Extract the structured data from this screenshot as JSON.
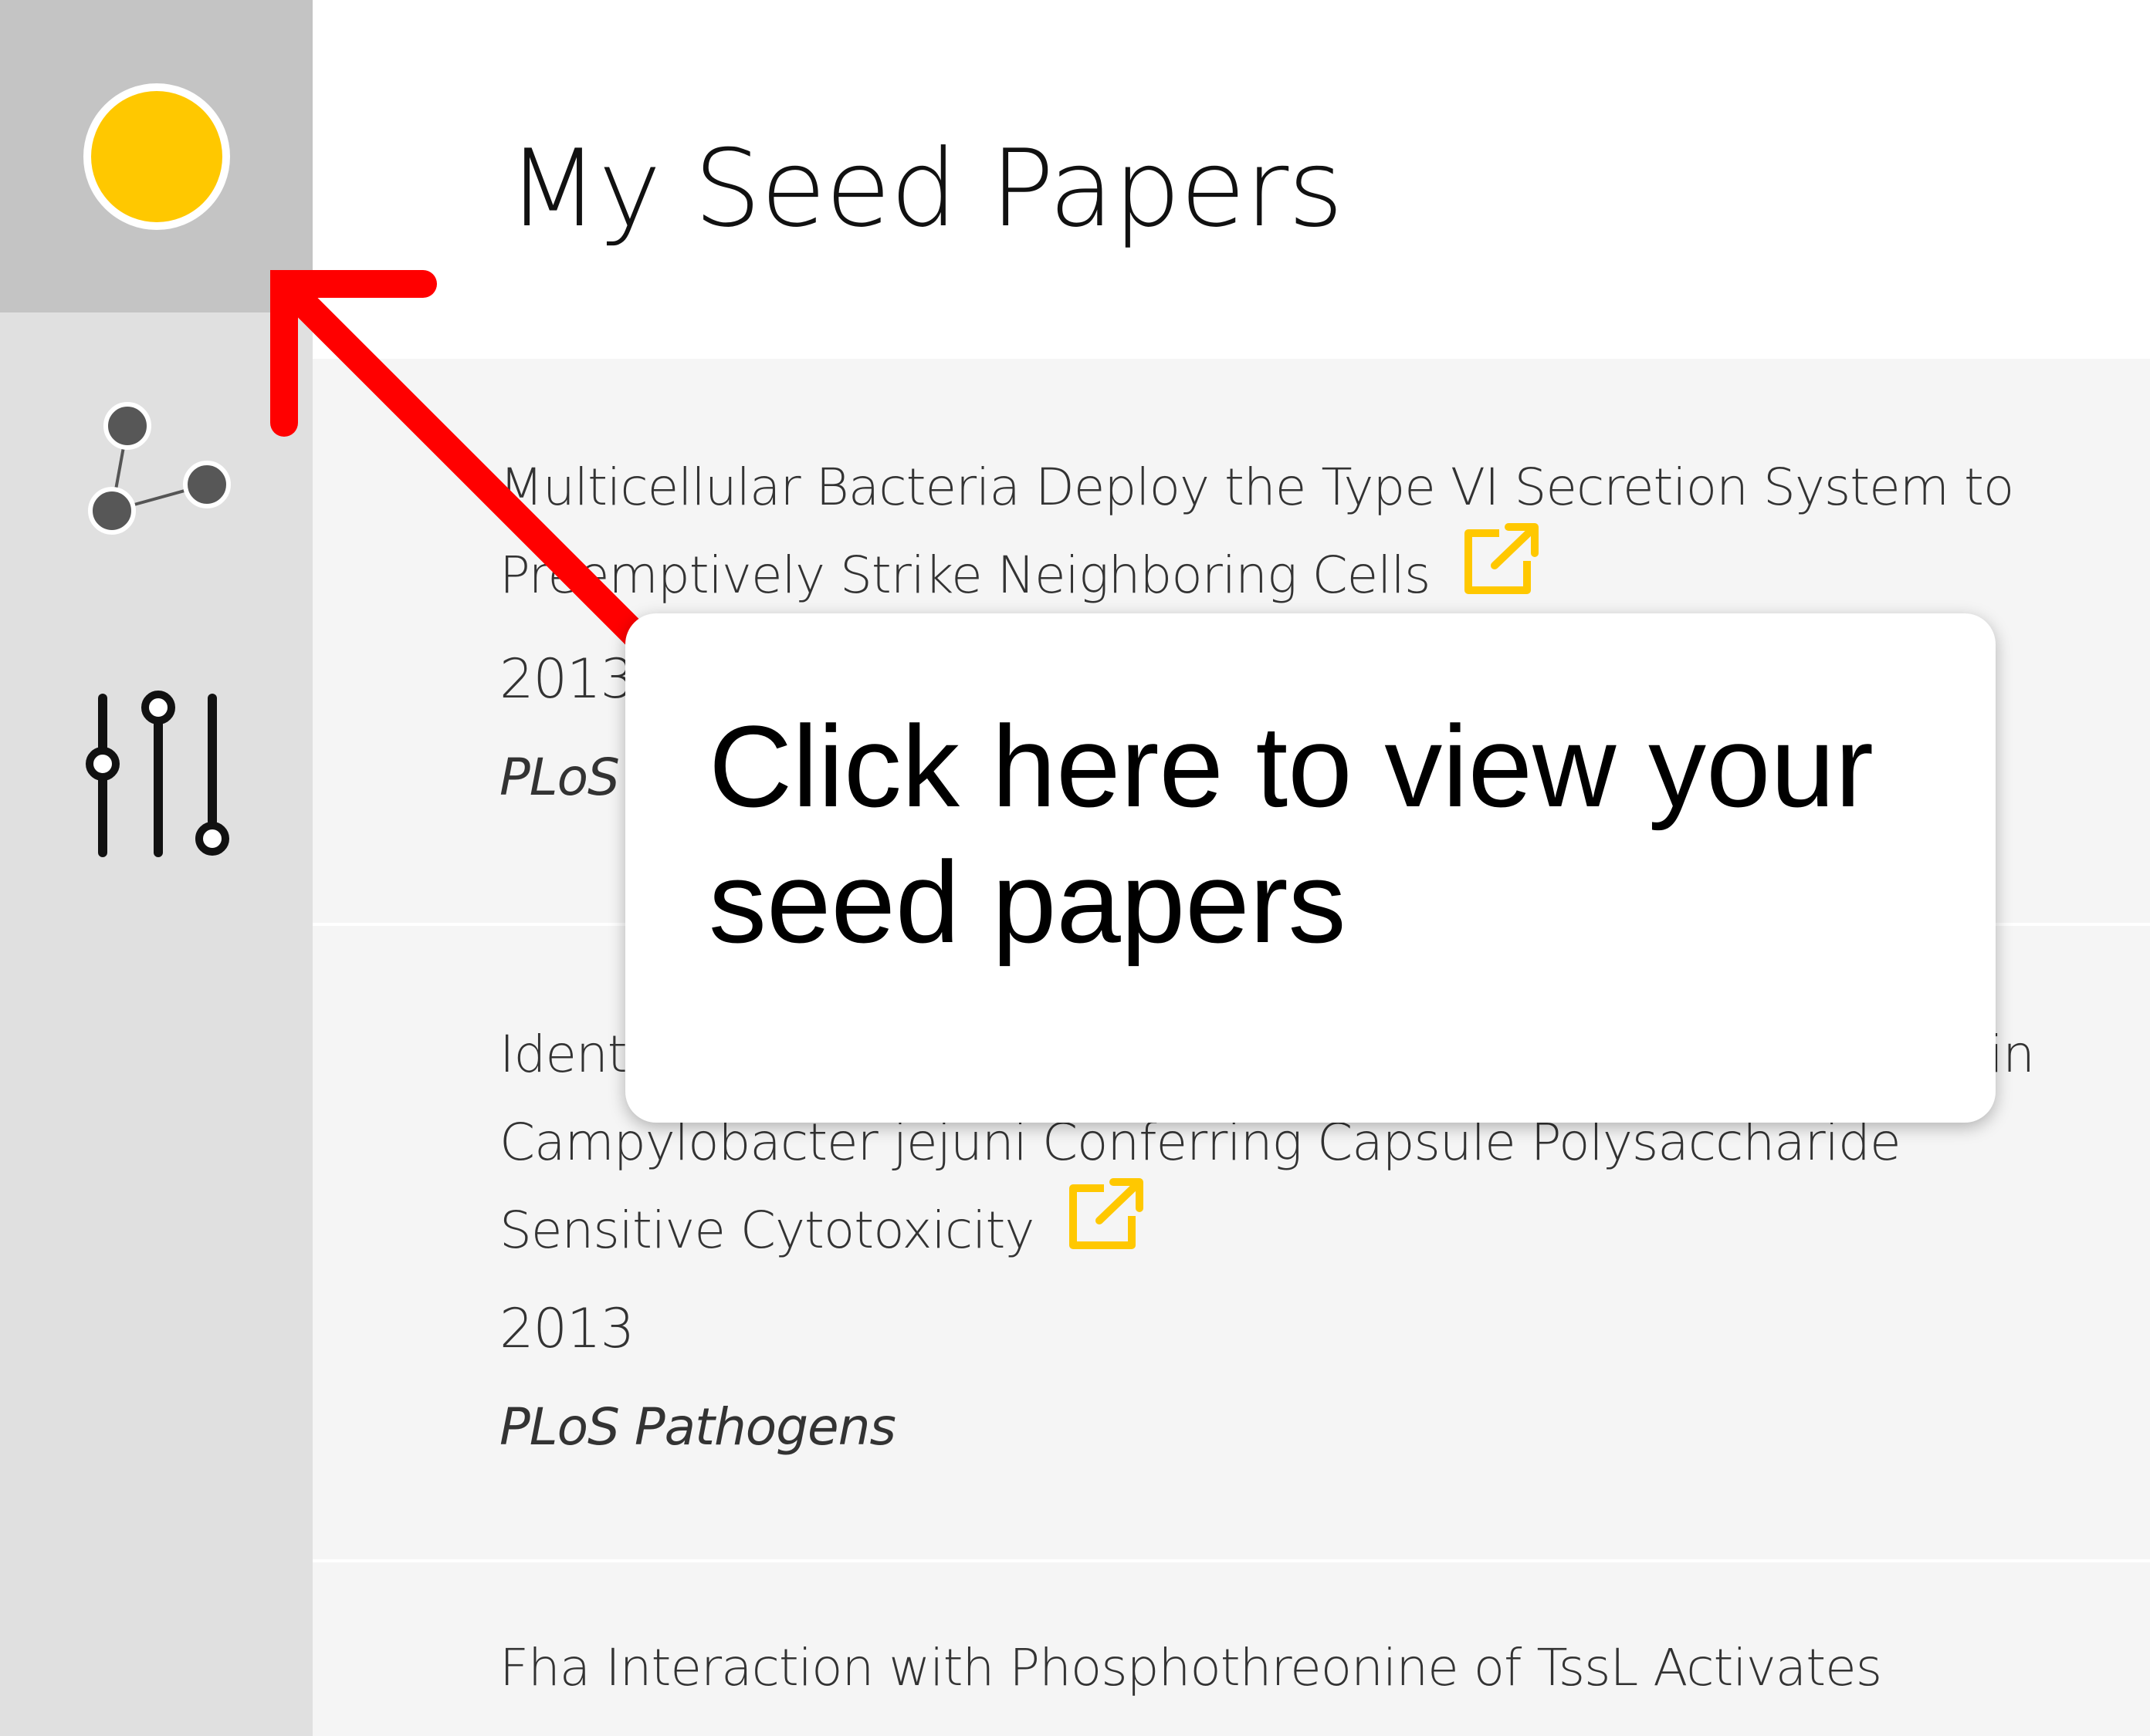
{
  "sidebar": {
    "items": [
      {
        "name": "seed-papers",
        "icon": "yellow-circle-icon",
        "active": true
      },
      {
        "name": "network",
        "icon": "network-graph-icon",
        "active": false
      },
      {
        "name": "filters",
        "icon": "sliders-icon",
        "active": false
      }
    ]
  },
  "main": {
    "title": "My Seed Papers",
    "papers": [
      {
        "title": "Multicellular Bacteria Deploy the Type VI Secretion System to Preemptively Strike Neighboring Cells",
        "year": "2013",
        "journal": "PLoS Pathogens"
      },
      {
        "title": "Identification of a Type VI Secretion System Encoding Locus in Campylobacter jejuni Conferring Capsule Polysaccharide Sensitive Cytotoxicity",
        "year": "2013",
        "journal": "PLoS Pathogens"
      },
      {
        "title": "Fha Interaction with Phosphothreonine of TssL Activates",
        "year": "",
        "journal": ""
      }
    ]
  },
  "tooltip": {
    "text": "Click here to view your seed papers"
  },
  "colors": {
    "accent": "#ffc800",
    "arrow": "#ff0000",
    "sidebar_bg": "#e0e0e0",
    "sidebar_active_bg": "#c4c4c4",
    "list_bg": "#f5f5f5"
  }
}
